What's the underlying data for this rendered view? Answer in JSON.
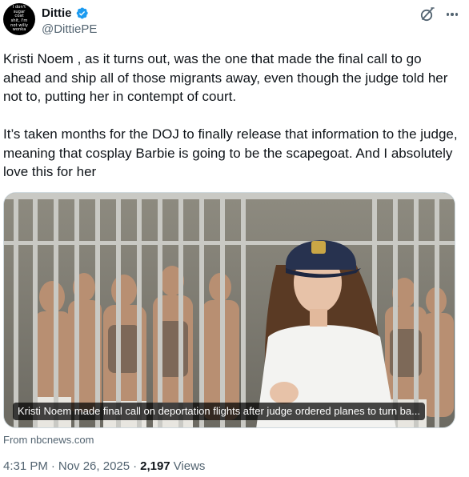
{
  "author": {
    "display_name": "Dittie",
    "handle": "@DittiePE",
    "avatar_text": "I don't\nsugar\ncoat\nshit, I'm\nnot willy\nwonka",
    "verified": true
  },
  "tweet": {
    "text": "Kristi Noem , as it turns out, was the one that made the final call to go ahead and ship all of those migrants away, even though the judge told her not to, putting her in contempt of court.\n\nIt’s taken months for the DOJ  to finally release that information to the judge, meaning that cosplay Barbie is going to be the scapegoat.  And I absolutely love this for her"
  },
  "card": {
    "caption": "Kristi Noem made final call on deportation flights after judge ordered planes to turn ba...",
    "source": "From nbcnews.com"
  },
  "meta": {
    "time": "4:31 PM",
    "separator": "·",
    "date": "Nov 26, 2025",
    "views_count": "2,197",
    "views_label": "Views"
  },
  "icons": {
    "verified": "verified-badge-icon",
    "grok": "grok-icon",
    "more": "more-options-icon"
  },
  "colors": {
    "accent": "#1d9bf0",
    "text": "#0f1419",
    "secondary": "#536471"
  }
}
